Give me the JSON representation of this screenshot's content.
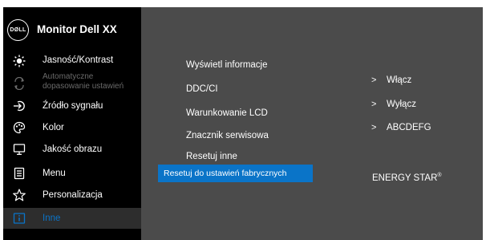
{
  "brand": {
    "logo_text": "DØLL",
    "model": "Monitor Dell XX"
  },
  "sidebar": {
    "items": [
      {
        "label": "Jasność/Kontrast",
        "icon": "brightness-icon"
      },
      {
        "label": "Automatyczne dopasowanie ustawień",
        "icon": "auto-adjust-icon",
        "disabled": true
      },
      {
        "label": "Źródło sygnału",
        "icon": "input-source-icon"
      },
      {
        "label": "Kolor",
        "icon": "color-palette-icon"
      },
      {
        "label": "Jakość obrazu",
        "icon": "display-icon"
      },
      {
        "label": "Menu",
        "icon": "menu-document-icon"
      },
      {
        "label": "Personalizacja",
        "icon": "star-icon"
      },
      {
        "label": "Inne",
        "icon": "info-icon",
        "active": true
      }
    ]
  },
  "submenu": {
    "items": [
      "Wyświetl informacje",
      "DDC/CI",
      "Warunkowanie LCD",
      "Znacznik serwisowa",
      "Resetuj inne",
      "Resetuj do ustawień fabrycznych"
    ],
    "selected_index": 5
  },
  "values": {
    "ddc_ci": "Włącz",
    "lcd_conditioning": "Wyłącz",
    "service_tag": "ABCDEFG",
    "chevron": ">"
  },
  "energy_star": {
    "text": "ENERGY STAR",
    "mark": "®"
  },
  "colors": {
    "accent": "#0a74c8",
    "sidebar_bg": "#000000",
    "panel_bg": "#4b4b4b"
  }
}
